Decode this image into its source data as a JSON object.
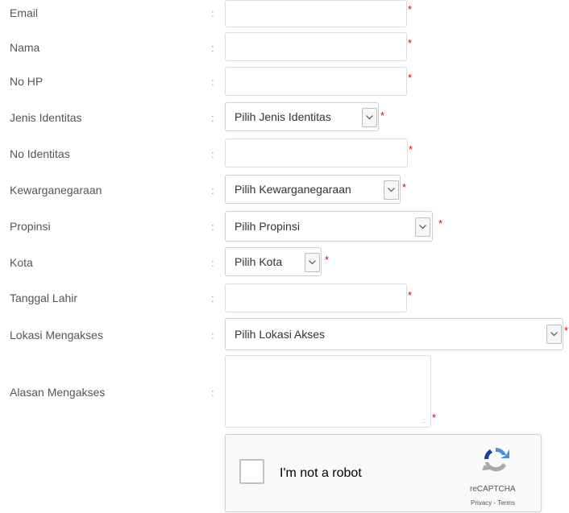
{
  "form": {
    "fields": [
      {
        "label": "Email",
        "value": ""
      },
      {
        "label": "Nama",
        "value": ""
      },
      {
        "label": "No HP",
        "value": ""
      },
      {
        "label": "Jenis Identitas",
        "selected": "Pilih Jenis Identitas"
      },
      {
        "label": "No Identitas",
        "value": ""
      },
      {
        "label": "Kewarganegaraan",
        "selected": "Pilih Kewarganegaraan"
      },
      {
        "label": "Propinsi",
        "selected": "Pilih Propinsi"
      },
      {
        "label": "Kota",
        "selected": "Pilih Kota"
      },
      {
        "label": "Tanggal Lahir",
        "value": ""
      },
      {
        "label": "Lokasi Mengakses",
        "selected": "Pilih Lokasi Akses"
      },
      {
        "label": "Alasan Mengakses",
        "value": ""
      }
    ],
    "colon": ":",
    "required_mark": "*",
    "resize_grip": ".::"
  },
  "captcha": {
    "checkbox_label": "I'm not a robot",
    "brand": "reCAPTCHA",
    "links": "Privacy - Terms",
    "logo_icon": "recaptcha-logo-icon"
  },
  "colors": {
    "required": "#dd0000",
    "border": "#dcdcdc",
    "label_text": "#555555"
  }
}
